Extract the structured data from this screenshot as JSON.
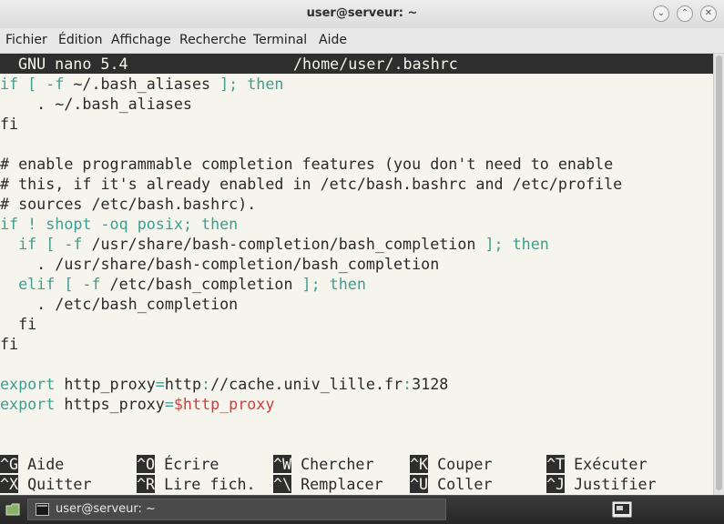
{
  "window": {
    "title": "user@serveur: ~"
  },
  "menu": {
    "items": [
      "Fichier",
      "Édition",
      "Affichage",
      "Recherche",
      "Terminal",
      "Aide"
    ]
  },
  "nano": {
    "version": "GNU nano 5.4",
    "file": "/home/user/.bashrc"
  },
  "code": {
    "l1a": "if [ ",
    "l1b": "-f",
    "l1c": " ~/.bash_aliases ",
    "l1d": "]; then",
    "l2": "    . ~/.bash_aliases",
    "l3": "fi",
    "l4": "# enable programmable completion features (you don't need to enable",
    "l5": "# this, if it's already enabled in /etc/bash.bashrc and /etc/profile",
    "l6": "# sources /etc/bash.bashrc).",
    "l7a": "if ! shopt -oq posix",
    "l7b": "; then",
    "l8a": "  if [ ",
    "l8b": "-f",
    "l8c": " /usr/share/bash-completion/bash_completion ",
    "l8d": "]; then",
    "l9": "    . /usr/share/bash-completion/bash_completion",
    "l10a": "  elif [ ",
    "l10b": "-f",
    "l10c": " /etc/bash_completion ",
    "l10d": "]; then",
    "l11": "    . /etc/bash_completion",
    "l12": "  fi",
    "l13": "fi",
    "l14a": "export",
    "l14b": " http_proxy",
    "l14c": "=",
    "l14d": "http",
    "l14e": ":",
    "l14f": "//cache.univ_lille.fr",
    "l14g": ":",
    "l14h": "3128",
    "l15a": "export",
    "l15b": " https_proxy",
    "l15c": "=",
    "l15d": "$http_proxy"
  },
  "shortcuts": {
    "row1": [
      {
        "key": "^G",
        "label": " Aide"
      },
      {
        "key": "^O",
        "label": " Écrire"
      },
      {
        "key": "^W",
        "label": " Chercher"
      },
      {
        "key": "^K",
        "label": " Couper"
      },
      {
        "key": "^T",
        "label": " Exécuter"
      }
    ],
    "row2": [
      {
        "key": "^X",
        "label": " Quitter"
      },
      {
        "key": "^R",
        "label": " Lire fich."
      },
      {
        "key": "^\\",
        "label": " Remplacer"
      },
      {
        "key": "^U",
        "label": " Coller"
      },
      {
        "key": "^J",
        "label": " Justifier"
      }
    ]
  },
  "taskbar": {
    "task_label": "user@serveur: ~"
  },
  "colors": {
    "keyword": "#3e9e8f",
    "comment": "#3a8ea3",
    "variable": "#d43a3a",
    "background": "#f5f5ed"
  }
}
